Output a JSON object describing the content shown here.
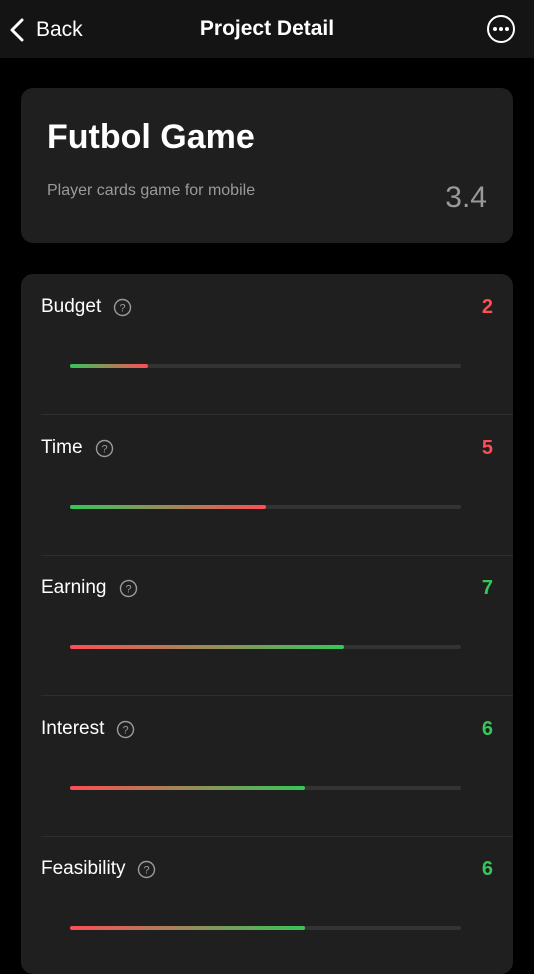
{
  "nav": {
    "back_label": "Back",
    "title": "Project Detail",
    "back_icon": "chevron-left-icon",
    "more_icon": "ellipsis-circle-icon"
  },
  "project": {
    "title": "Futbol Game",
    "subtitle": "Player cards game for mobile",
    "score": "3.4"
  },
  "colors": {
    "good": "#34c759",
    "bad": "#ff4d56",
    "muted": "#9a9a9a"
  },
  "metrics": [
    {
      "label": "Budget",
      "value": "2",
      "level": 2,
      "tone": "bad"
    },
    {
      "label": "Time",
      "value": "5",
      "level": 5,
      "tone": "bad"
    },
    {
      "label": "Earning",
      "value": "7",
      "level": 7,
      "tone": "good"
    },
    {
      "label": "Interest",
      "value": "6",
      "level": 6,
      "tone": "good"
    },
    {
      "label": "Feasibility",
      "value": "6",
      "level": 6,
      "tone": "good"
    }
  ],
  "scale_max": 10,
  "help_icon": "question-circle-icon"
}
